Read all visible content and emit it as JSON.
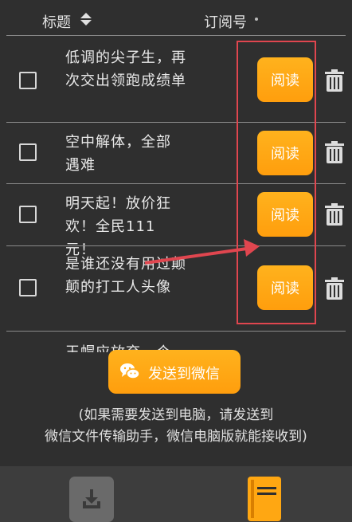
{
  "header": {
    "title": "标题",
    "subscription": "订阅号"
  },
  "articles": [
    {
      "title": "低调的尖子生，再次交出领跑成绩单",
      "read_label": "阅读"
    },
    {
      "title": "空中解体，全部遇难",
      "read_label": "阅读"
    },
    {
      "title": "明天起！放价狂欢！全民111元！",
      "read_label": "阅读"
    },
    {
      "title": "是谁还没有用过颠颠的打工人头像",
      "read_label": "阅读"
    },
    {
      "title": "王帽应放弃一个"
    }
  ],
  "send_button": {
    "label": "发送到微信"
  },
  "note": {
    "line1": "(如果需要发送到电脑，请发送到",
    "line2": "微信文件传输助手，微信电脑版就能接收到)"
  },
  "colors": {
    "accent": "#FFA712",
    "highlight": "#E0464F",
    "background": "#2F2F2F"
  },
  "icons": [
    "sort-icon",
    "trash-icon",
    "wechat-icon",
    "download-icon",
    "book-icon"
  ]
}
